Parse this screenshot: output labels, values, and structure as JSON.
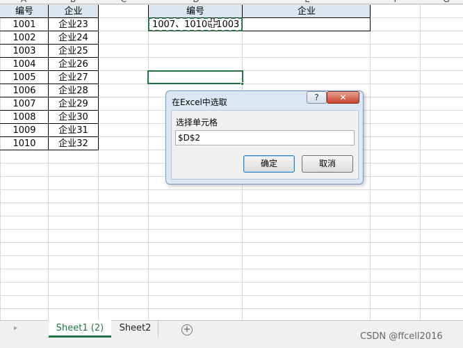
{
  "column_letters": [
    "A",
    "B",
    "C",
    "D",
    "E",
    "F",
    "G"
  ],
  "table1": {
    "headers": [
      "编号",
      "企业"
    ],
    "rows": [
      [
        "1001",
        "企业23"
      ],
      [
        "1002",
        "企业24"
      ],
      [
        "1003",
        "企业25"
      ],
      [
        "1004",
        "企业26"
      ],
      [
        "1005",
        "企业27"
      ],
      [
        "1006",
        "企业28"
      ],
      [
        "1007",
        "企业29"
      ],
      [
        "1008",
        "企业30"
      ],
      [
        "1009",
        "企业31"
      ],
      [
        "1010",
        "企业32"
      ]
    ]
  },
  "table2": {
    "headers": [
      "编号",
      "企业"
    ],
    "row1": {
      "id_value": "1007、1010、1003",
      "company_value": ""
    }
  },
  "dialog": {
    "title": "在Excel中选取",
    "help_label": "?",
    "close_label": "✕",
    "field_label": "选择单元格",
    "input_value": "$D$2",
    "ok_label": "确定",
    "cancel_label": "取消"
  },
  "sheet_tabs": [
    {
      "label": "Sheet1 (2)",
      "active": true
    },
    {
      "label": "Sheet2",
      "active": false
    }
  ],
  "add_sheet_icon": "plus-circle-icon",
  "watermark": "CSDN @ffcell2016",
  "colors": {
    "accent": "#217346",
    "header_fill": "#dce6f1"
  }
}
